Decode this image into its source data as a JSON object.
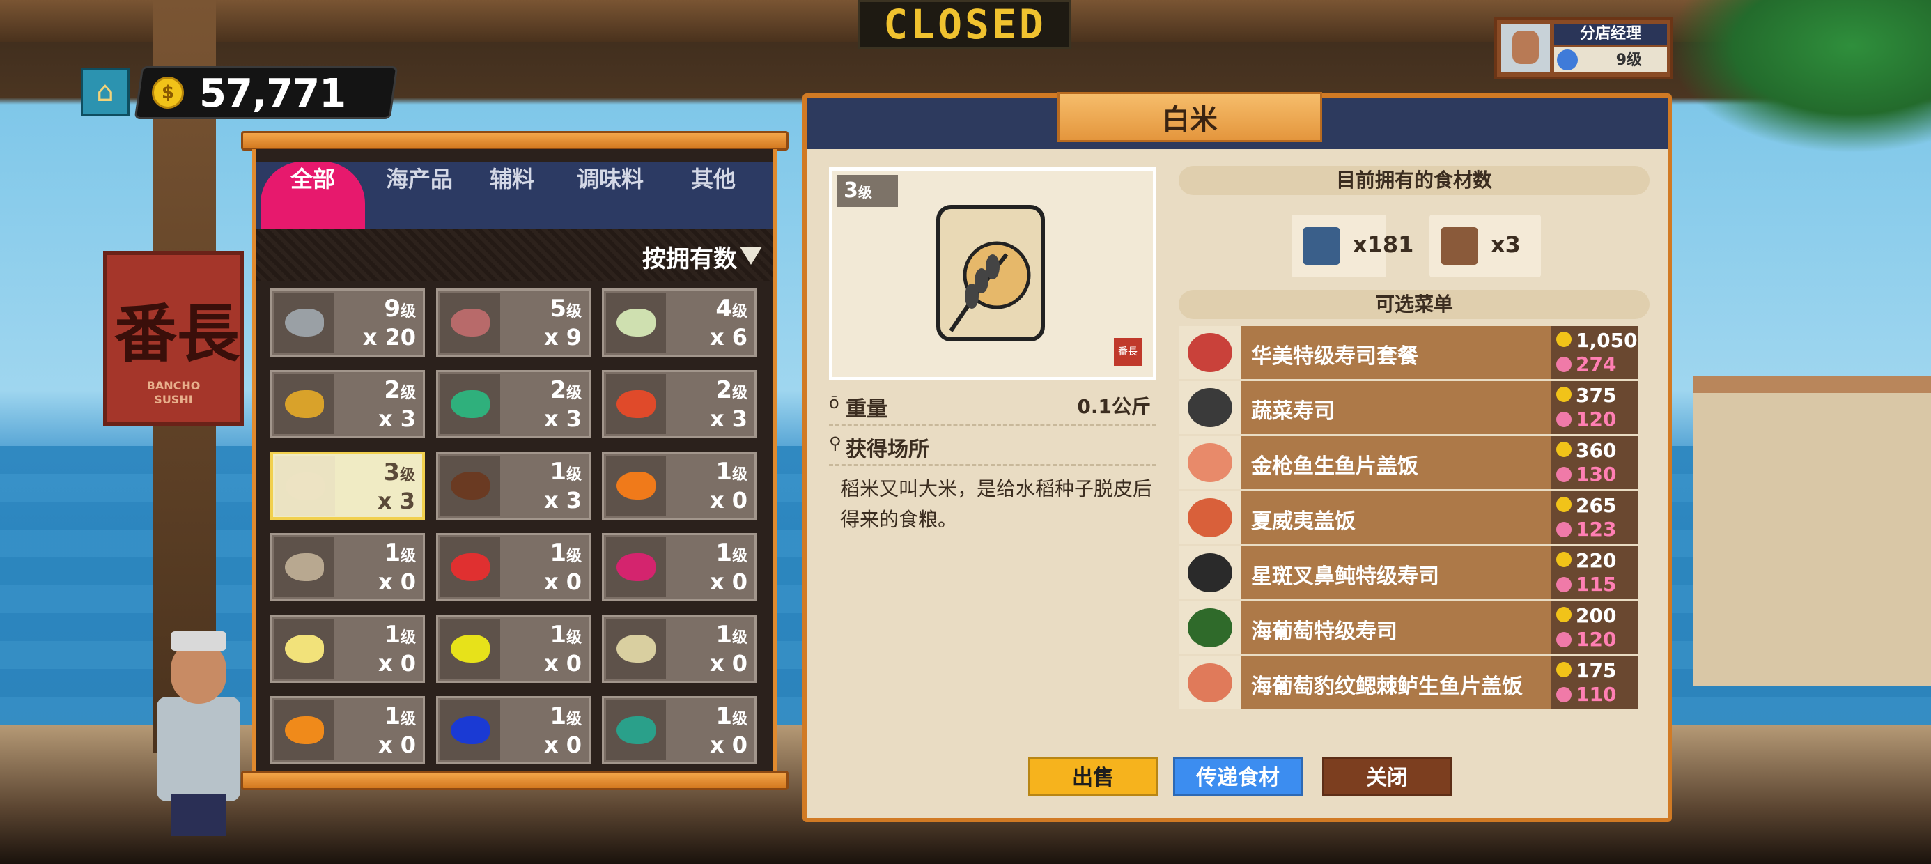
{
  "scene": {
    "closed_sign": "CLOSED",
    "shop_sign_kanji": "番長",
    "shop_sign_sub": "BANCHO\nSUSHI"
  },
  "hud": {
    "gold": "57,771",
    "coin_symbol": "$"
  },
  "manager": {
    "title": "分店经理",
    "level": "9级"
  },
  "inventory": {
    "tabs": [
      {
        "label": "全部",
        "active": true
      },
      {
        "label": "海产品"
      },
      {
        "label": "辅料"
      },
      {
        "label": "调味料"
      },
      {
        "label": "其他"
      }
    ],
    "sort_label": "按拥有数",
    "items": [
      {
        "level": "9",
        "unit": "级",
        "qty": "x 20",
        "icon": "shark-head-icon",
        "color": "#9aa0a5"
      },
      {
        "level": "5",
        "unit": "级",
        "qty": "x 9",
        "icon": "seahorse-icon",
        "color": "#b86a6a"
      },
      {
        "level": "4",
        "unit": "级",
        "qty": "x 6",
        "icon": "rice-bag-icon",
        "color": "#cfe0b0"
      },
      {
        "level": "2",
        "unit": "级",
        "qty": "x 3",
        "icon": "pufferfish-icon",
        "color": "#d9a22a"
      },
      {
        "level": "2",
        "unit": "级",
        "qty": "x 3",
        "icon": "green-wrasse-icon",
        "color": "#2fb07c"
      },
      {
        "level": "2",
        "unit": "级",
        "qty": "x 3",
        "icon": "red-snapper-icon",
        "color": "#e04a2a"
      },
      {
        "level": "3",
        "unit": "级",
        "qty": "x 3",
        "icon": "white-rice-icon",
        "color": "#ede3c3",
        "selected": true
      },
      {
        "level": "1",
        "unit": "级",
        "qty": "x 3",
        "icon": "miso-jar-icon",
        "color": "#6a3a22"
      },
      {
        "level": "1",
        "unit": "级",
        "qty": "x 0",
        "icon": "clownfish-icon",
        "color": "#f07a1a"
      },
      {
        "level": "1",
        "unit": "级",
        "qty": "x 0",
        "icon": "sardine-icon",
        "color": "#b8a890"
      },
      {
        "level": "1",
        "unit": "级",
        "qty": "x 0",
        "icon": "small-red-fish-icon",
        "color": "#e03030"
      },
      {
        "level": "1",
        "unit": "级",
        "qty": "x 0",
        "icon": "pink-fish-icon",
        "color": "#d4246e"
      },
      {
        "level": "1",
        "unit": "级",
        "qty": "x 0",
        "icon": "yellow-white-fish-icon",
        "color": "#f2e27a"
      },
      {
        "level": "1",
        "unit": "级",
        "qty": "x 0",
        "icon": "yellow-tang-icon",
        "color": "#e7e21a"
      },
      {
        "level": "1",
        "unit": "级",
        "qty": "x 0",
        "icon": "striped-jack-icon",
        "color": "#d9cfa0"
      },
      {
        "level": "1",
        "unit": "级",
        "qty": "x 0",
        "icon": "orange-lionfish-icon",
        "color": "#f08a1a"
      },
      {
        "level": "1",
        "unit": "级",
        "qty": "x 0",
        "icon": "blue-tang-icon",
        "color": "#1a3ad4"
      },
      {
        "level": "1",
        "unit": "级",
        "qty": "x 0",
        "icon": "green-parrotfish-icon",
        "color": "#2aa08a"
      }
    ]
  },
  "detail": {
    "title": "白米",
    "level": "3",
    "level_unit": "级",
    "stamp": "番長",
    "weight_label": "重量",
    "weight_value": "0.1公斤",
    "source_label": "获得场所",
    "description": "稻米又叫大米，是给水稻种子脱皮后得来的食粮。",
    "stock_header": "目前拥有的食材数",
    "stock": [
      {
        "icon": "restaurant-storage-icon",
        "qty": "x181"
      },
      {
        "icon": "boat-storage-icon",
        "qty": "x3"
      }
    ],
    "menu_header": "可选菜单",
    "menu": [
      {
        "name": "华美特级寿司套餐",
        "price": "1,050",
        "taste": "274",
        "color": "#c9413a"
      },
      {
        "name": "蔬菜寿司",
        "price": "375",
        "taste": "120",
        "color": "#3a3a3a"
      },
      {
        "name": "金枪鱼生鱼片盖饭",
        "price": "360",
        "taste": "130",
        "color": "#e88a6a"
      },
      {
        "name": "夏威夷盖饭",
        "price": "265",
        "taste": "123",
        "color": "#d9603a"
      },
      {
        "name": "星斑叉鼻鲀特级寿司",
        "price": "220",
        "taste": "115",
        "color": "#2a2a2a"
      },
      {
        "name": "海葡萄特级寿司",
        "price": "200",
        "taste": "120",
        "color": "#2f6a2a"
      },
      {
        "name": "海葡萄豹纹鳃棘鲈生鱼片盖饭",
        "price": "175",
        "taste": "110",
        "color": "#e07a5a"
      }
    ],
    "buttons": {
      "sell": "出售",
      "pass": "传递食材",
      "close": "关闭"
    }
  }
}
